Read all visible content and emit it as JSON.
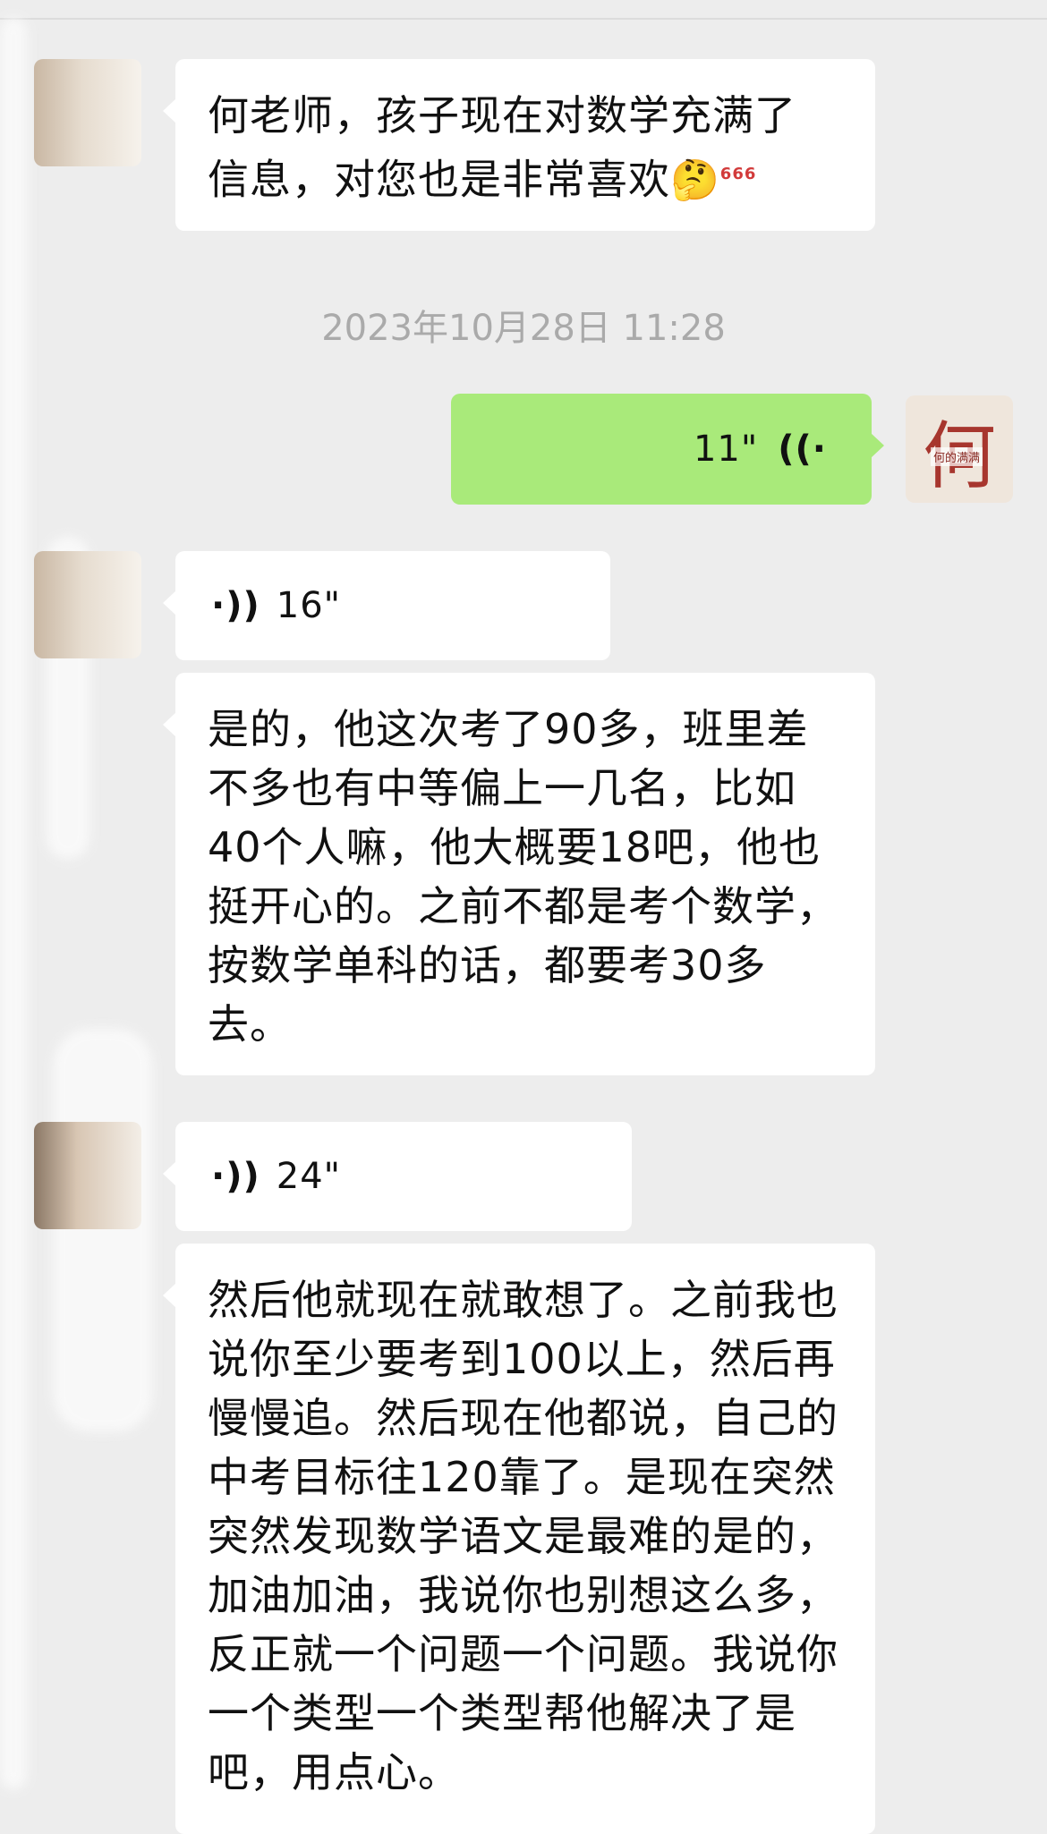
{
  "messages": [
    {
      "type": "text",
      "side": "left",
      "text_lines": [
        "何老师，孩子现在对数学充满了",
        "信息，对您也是非常喜欢"
      ],
      "emoji": "🤔",
      "emoji_badge": "666"
    },
    {
      "type": "timestamp",
      "text": "2023年10月28日 11:28"
    },
    {
      "type": "voice",
      "side": "right",
      "duration": "11\""
    },
    {
      "type": "voice",
      "side": "left",
      "duration": "16\""
    },
    {
      "type": "text",
      "side": "left",
      "text": "是的，他这次考了90多，班里差不多也有中等偏上一几名，比如40个人嘛，他大概要18吧，他也挺开心的。之前不都是考个数学，按数学单科的话，都要考30多去。"
    },
    {
      "type": "voice",
      "side": "left",
      "duration": "24\""
    },
    {
      "type": "text",
      "side": "left",
      "text": "然后他就现在就敢想了。之前我也说你至少要考到100以上，然后再慢慢追。然后现在他都说，自己的中考目标往120靠了。是现在突然突然发现数学语文是最难的是的，加油加油，我说你也别想这么多，反正就一个问题一个问题。我说你一个类型一个类型帮他解决了是吧，用点心。"
    }
  ],
  "avatars": {
    "self_char": "何",
    "self_tag": "何的满满"
  },
  "colors": {
    "background": "#ededed",
    "sent_bubble": "#a9ea7a",
    "received_bubble": "#ffffff",
    "timestamp": "#aaaaaa"
  }
}
